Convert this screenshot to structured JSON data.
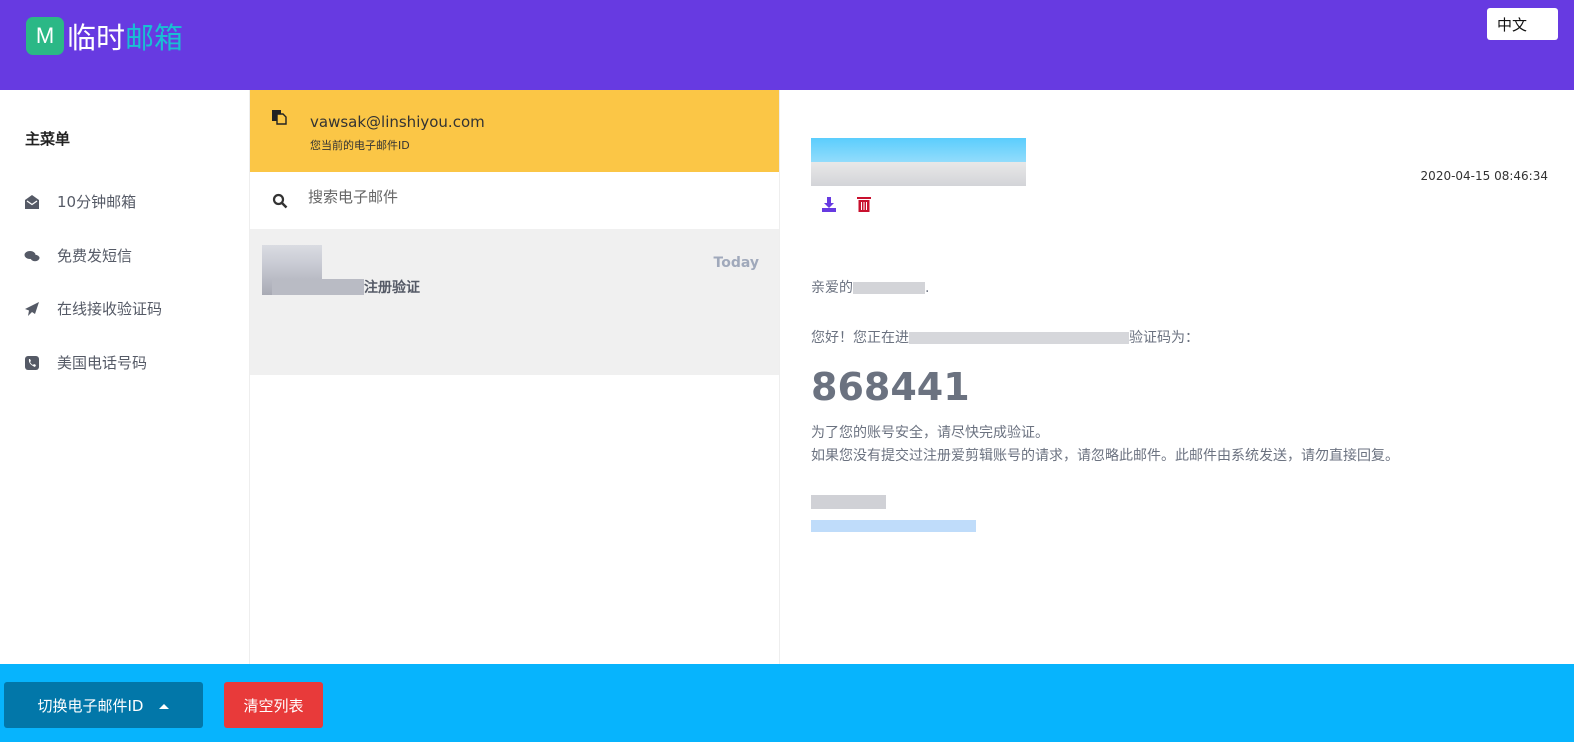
{
  "header": {
    "logo_mark": "M",
    "logo_text_1": "临时",
    "logo_text_2": "邮箱",
    "language": "中文"
  },
  "sidebar": {
    "title": "主菜单",
    "items": [
      {
        "label": "10分钟邮箱",
        "icon": "envelope-open-icon"
      },
      {
        "label": "免费发短信",
        "icon": "comments-icon"
      },
      {
        "label": "在线接收验证码",
        "icon": "paper-plane-icon"
      },
      {
        "label": "美国电话号码",
        "icon": "phone-square-icon"
      }
    ]
  },
  "mailbox": {
    "email": "vawsak@linshiyou.com",
    "email_caption": "您当前的电子邮件ID",
    "search_placeholder": "搜索电子邮件",
    "messages": [
      {
        "subject_visible": "注册验证",
        "date": "Today"
      }
    ]
  },
  "reader": {
    "datetime": "2020-04-15 08:46:34",
    "greeting": "亲爱的",
    "greeting_end": ".",
    "line1_start": "您好！您正在进",
    "line1_end": "验证码为：",
    "code": "868441",
    "line2": "为了您的账号安全，请尽快完成验证。",
    "line3": "如果您没有提交过注册爱剪辑账号的请求，请忽略此邮件。此邮件由系统发送，请勿直接回复。"
  },
  "footer": {
    "switch_label": "切换电子邮件ID",
    "clear_label": "清空列表"
  },
  "colors": {
    "header": "#673ae1",
    "footer": "#07b4fd",
    "id_box": "#fbc646",
    "switch_button": "#0277a9",
    "clear_button": "#e83a3a"
  }
}
